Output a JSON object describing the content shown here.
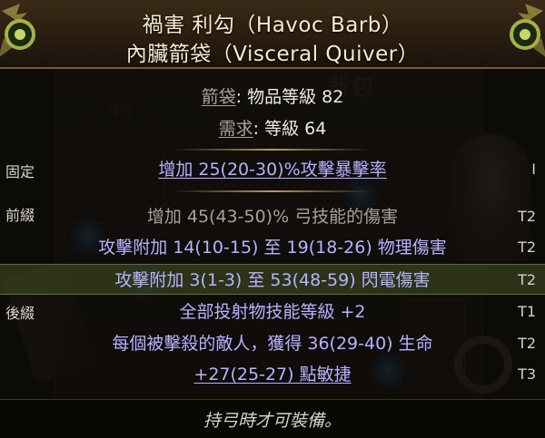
{
  "item": {
    "name_line1": "禍害 利勾（Havoc Barb）",
    "name_line2": "內臟箭袋（Visceral Quiver）",
    "type_label": "箭袋",
    "item_level_text": ": 物品等級 82",
    "requirement_label": "需求",
    "requirement_text": ": 等級 64"
  },
  "background": {
    "title": "背包",
    "small_title": "背包"
  },
  "sections": {
    "implicit": "固定",
    "prefix": "前綴",
    "suffix": "後綴"
  },
  "mods": [
    {
      "text": "增加 25(20-30)%攻擊暴擊率",
      "tier": "I",
      "style": "magic",
      "underline": true
    },
    {
      "text": "增加 45(43-50)% 弓技能的傷害",
      "tier": "T2",
      "style": "gray",
      "underline": false
    },
    {
      "text": "攻擊附加 14(10-15) 至 19(18-26) 物理傷害",
      "tier": "T2",
      "style": "magic",
      "underline": false
    },
    {
      "text": "攻擊附加 3(1-3) 至 53(48-59) 閃電傷害",
      "tier": "T2",
      "style": "magic",
      "underline": false
    },
    {
      "text": "全部投射物技能等級 +2",
      "tier": "T1",
      "style": "magic",
      "underline": false
    },
    {
      "text": "每個被擊殺的敵人，獲得 36(29-40) 生命",
      "tier": "T2",
      "style": "magic",
      "underline": false
    },
    {
      "text": "+27(25-27) 點敏捷",
      "tier": "T3",
      "style": "magic",
      "underline": true
    }
  ],
  "footer": "持弓時才可裝備。",
  "icons": [
    "ornament-left-icon",
    "ornament-right-icon"
  ],
  "colors": {
    "magic": "#b8b2ff",
    "header_text": "#f6ebcf",
    "highlight_row": "#465426"
  }
}
